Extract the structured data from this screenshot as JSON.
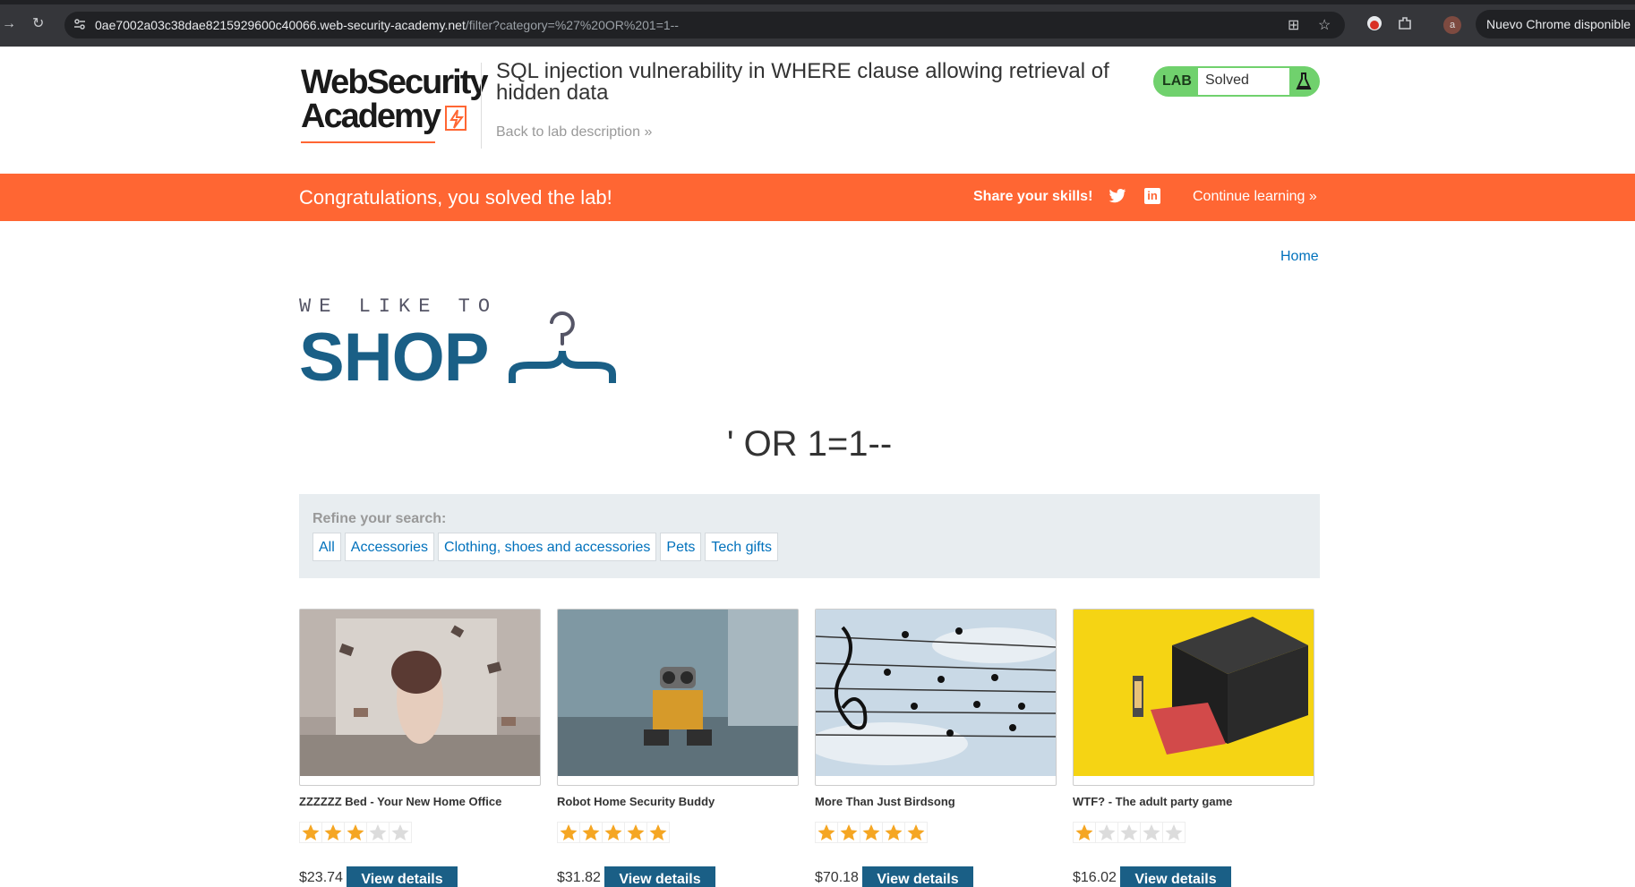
{
  "browser": {
    "url_host": "0ae7002a03c38dae8215929600c40066.web-security-academy.net",
    "url_path": "/filter?category=%27%20OR%201=1--",
    "update_label": "Nuevo Chrome disponible",
    "avatar_letter": "a"
  },
  "header": {
    "logo_line1": "WebSecurity",
    "logo_line2": "Academy",
    "lab_title": "SQL injection vulnerability in WHERE clause allowing retrieval of hidden data",
    "back_link": "Back to lab description",
    "lab_label": "LAB",
    "lab_status": "Solved"
  },
  "banner": {
    "congrats": "Congratulations, you solved the lab!",
    "share": "Share your skills!",
    "continue": "Continue learning"
  },
  "nav": {
    "home": "Home"
  },
  "shop_logo": {
    "small": "WE LIKE TO",
    "big": "SHOP"
  },
  "page": {
    "heading": "' OR 1=1--"
  },
  "filters": {
    "label": "Refine your search:",
    "categories": [
      "All",
      "Accessories",
      "Clothing, shoes and accessories",
      "Pets",
      "Tech gifts"
    ]
  },
  "products": [
    {
      "name": "ZZZZZZ Bed - Your New Home Office",
      "rating": 3,
      "price": "$23.74",
      "button": "View details"
    },
    {
      "name": "Robot Home Security Buddy",
      "rating": 5,
      "price": "$31.82",
      "button": "View details"
    },
    {
      "name": "More Than Just Birdsong",
      "rating": 5,
      "price": "$70.18",
      "button": "View details"
    },
    {
      "name": "WTF? - The adult party game",
      "rating": 1,
      "price": "$16.02",
      "button": "View details"
    }
  ],
  "colors": {
    "accent_orange": "#ff6633",
    "solved_green": "#70d16d",
    "link_blue": "#0071bc",
    "button_blue": "#1a5f86"
  }
}
